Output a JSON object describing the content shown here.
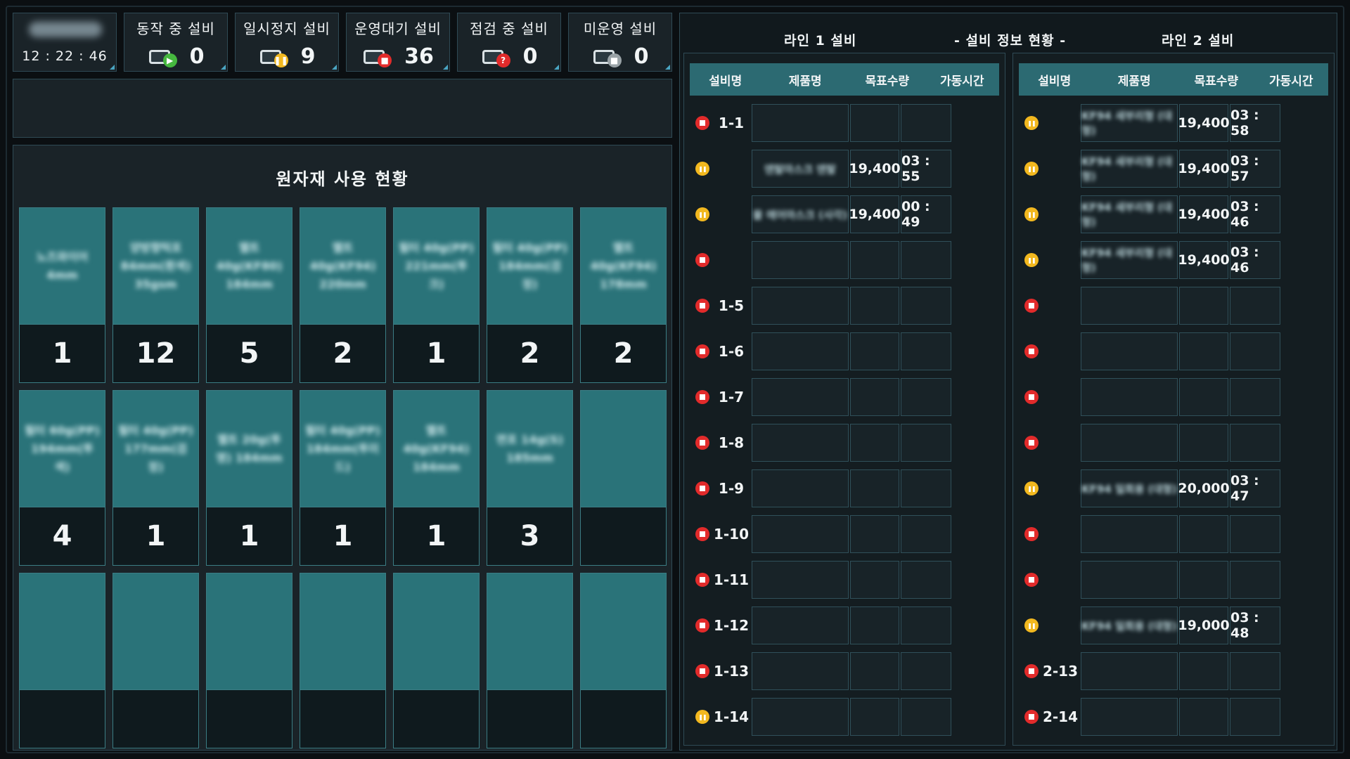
{
  "clock": {
    "time": "12 : 22 : 46"
  },
  "stats": [
    {
      "label": "동작 중 설비",
      "value": "0",
      "icon": "running-machine-icon",
      "badge": "run"
    },
    {
      "label": "일시정지 설비",
      "value": "9",
      "icon": "paused-machine-icon",
      "badge": "pause"
    },
    {
      "label": "운영대기 설비",
      "value": "36",
      "icon": "standby-machine-icon",
      "badge": "stop"
    },
    {
      "label": "점검 중 설비",
      "value": "0",
      "icon": "inspection-machine-icon",
      "badge": "check"
    },
    {
      "label": "미운영 설비",
      "value": "0",
      "icon": "idle-machine-icon",
      "badge": "idle"
    }
  ],
  "materials": {
    "title": "원자재 사용 현황",
    "items": [
      {
        "name": "노즈와이어 4mm",
        "count": "1"
      },
      {
        "name": "양방향턱포 84mm(흰색) 35gsm",
        "count": "12"
      },
      {
        "name": "멜트 40g(KF80) 184mm",
        "count": "5"
      },
      {
        "name": "멜트 40g(KF94) 220mm",
        "count": "2"
      },
      {
        "name": "필터 40g(PP) 221mm(투크)",
        "count": "1"
      },
      {
        "name": "필터 40g(PP) 184mm(검정)",
        "count": "2"
      },
      {
        "name": "멜트 40g(KF94) 178mm",
        "count": "2"
      },
      {
        "name": "필터 60g(PP) 194mm(투색)",
        "count": "4"
      },
      {
        "name": "필터 40g(PP) 177mm(검정)",
        "count": "1"
      },
      {
        "name": "멜트 20g(투명) 184mm",
        "count": "1"
      },
      {
        "name": "필터 40g(PP) 184mm(투미드)",
        "count": "1"
      },
      {
        "name": "멜트 40g(KF94) 184mm",
        "count": "1"
      },
      {
        "name": "면포 14g(S) 185mm",
        "count": "3"
      },
      {
        "name": "",
        "count": ""
      },
      {
        "name": "",
        "count": ""
      },
      {
        "name": "",
        "count": ""
      },
      {
        "name": "",
        "count": ""
      },
      {
        "name": "",
        "count": ""
      },
      {
        "name": "",
        "count": ""
      },
      {
        "name": "",
        "count": ""
      },
      {
        "name": "",
        "count": ""
      }
    ]
  },
  "info": {
    "title": "- 설비 정보 현황 -",
    "columns": [
      "설비명",
      "제품명",
      "목표수량",
      "가동시간"
    ],
    "line1": {
      "title": "라인 1 설비",
      "rows": [
        {
          "status": "stop",
          "id": "1-1",
          "product": "",
          "target": "",
          "time": ""
        },
        {
          "status": "pause",
          "id": "",
          "product": "덴탈마스크 덴탈",
          "target": "19,400",
          "time": "03 : 55"
        },
        {
          "status": "pause",
          "id": "",
          "product": "몰 에어마스크 (사각)",
          "target": "19,400",
          "time": "00 : 49"
        },
        {
          "status": "stop",
          "id": "",
          "product": "",
          "target": "",
          "time": ""
        },
        {
          "status": "stop",
          "id": "1-5",
          "product": "",
          "target": "",
          "time": ""
        },
        {
          "status": "stop",
          "id": "1-6",
          "product": "",
          "target": "",
          "time": ""
        },
        {
          "status": "stop",
          "id": "1-7",
          "product": "",
          "target": "",
          "time": ""
        },
        {
          "status": "stop",
          "id": "1-8",
          "product": "",
          "target": "",
          "time": ""
        },
        {
          "status": "stop",
          "id": "1-9",
          "product": "",
          "target": "",
          "time": ""
        },
        {
          "status": "stop",
          "id": "1-10",
          "product": "",
          "target": "",
          "time": ""
        },
        {
          "status": "stop",
          "id": "1-11",
          "product": "",
          "target": "",
          "time": ""
        },
        {
          "status": "stop",
          "id": "1-12",
          "product": "",
          "target": "",
          "time": ""
        },
        {
          "status": "stop",
          "id": "1-13",
          "product": "",
          "target": "",
          "time": ""
        },
        {
          "status": "pause",
          "id": "1-14",
          "product": "",
          "target": "",
          "time": ""
        }
      ]
    },
    "line2": {
      "title": "라인 2 설비",
      "rows": [
        {
          "status": "pause",
          "id": "",
          "product": "KF94 새부리형 (대형)",
          "target": "19,400",
          "time": "03 : 58"
        },
        {
          "status": "pause",
          "id": "",
          "product": "KF94 새부리형 (대형)",
          "target": "19,400",
          "time": "03 : 57"
        },
        {
          "status": "pause",
          "id": "",
          "product": "KF94 새부리형 (대형)",
          "target": "19,400",
          "time": "03 : 46"
        },
        {
          "status": "pause",
          "id": "",
          "product": "KF94 새부리형 (대형)",
          "target": "19,400",
          "time": "03 : 46"
        },
        {
          "status": "stop",
          "id": "",
          "product": "",
          "target": "",
          "time": ""
        },
        {
          "status": "stop",
          "id": "",
          "product": "",
          "target": "",
          "time": ""
        },
        {
          "status": "stop",
          "id": "",
          "product": "",
          "target": "",
          "time": ""
        },
        {
          "status": "stop",
          "id": "",
          "product": "",
          "target": "",
          "time": ""
        },
        {
          "status": "pause",
          "id": "",
          "product": "KF94 일회용 (대형)",
          "target": "20,000",
          "time": "03 : 47"
        },
        {
          "status": "stop",
          "id": "",
          "product": "",
          "target": "",
          "time": ""
        },
        {
          "status": "stop",
          "id": "",
          "product": "",
          "target": "",
          "time": ""
        },
        {
          "status": "pause",
          "id": "",
          "product": "KF94 일회용 (대형)",
          "target": "19,000",
          "time": "03 : 48"
        },
        {
          "status": "stop",
          "id": "2-13",
          "product": "",
          "target": "",
          "time": ""
        },
        {
          "status": "stop",
          "id": "2-14",
          "product": "",
          "target": "",
          "time": ""
        }
      ]
    }
  }
}
